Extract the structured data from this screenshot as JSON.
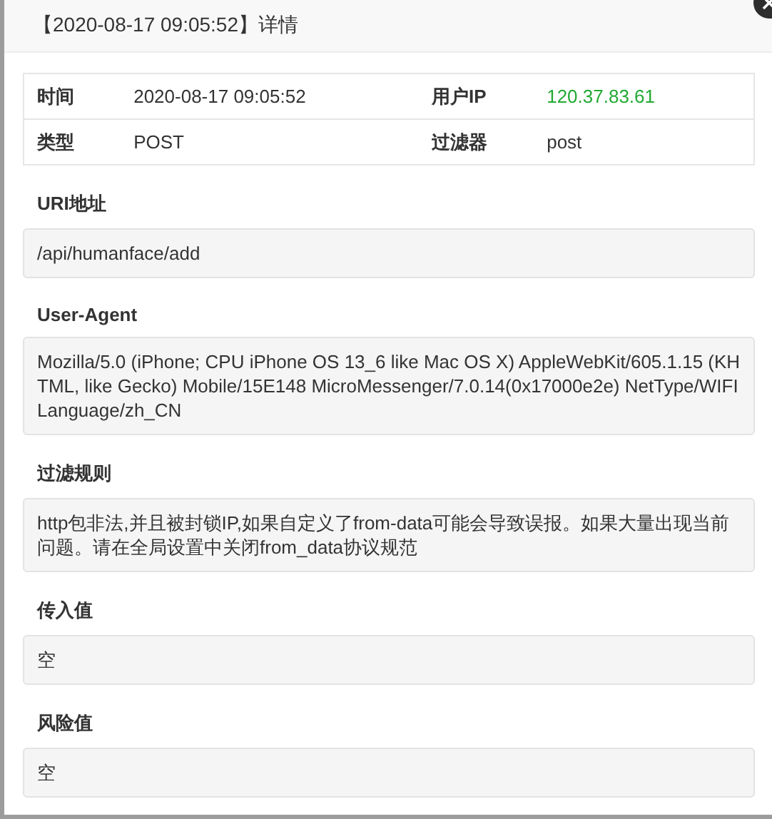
{
  "dialog": {
    "title": "【2020-08-17 09:05:52】详情"
  },
  "info_table": {
    "rows": [
      {
        "cells": [
          {
            "label": "时间",
            "value": "2020-08-17 09:05:52",
            "kind": "plain"
          },
          {
            "label": "用户IP",
            "value": "120.37.83.61",
            "kind": "highlight"
          }
        ]
      },
      {
        "cells": [
          {
            "label": "类型",
            "value": "POST",
            "kind": "plain"
          },
          {
            "label": "过滤器",
            "value": "post",
            "kind": "plain"
          }
        ]
      }
    ]
  },
  "sections": [
    {
      "label": "URI地址",
      "value": "/api/humanface/add"
    },
    {
      "label": "User-Agent",
      "value": "Mozilla/5.0 (iPhone; CPU iPhone OS 13_6 like Mac OS X) AppleWebKit/605.1.15 (KHTML, like Gecko) Mobile/15E148 MicroMessenger/7.0.14(0x17000e2e) NetType/WIFI Language/zh_CN"
    },
    {
      "label": "过滤规则",
      "value": "http包非法,并且被封锁IP,如果自定义了from-data可能会导致误报。如果大量出现当前问题。请在全局设置中关闭from_data协议规范"
    },
    {
      "label": "传入值",
      "value": "空"
    },
    {
      "label": "风险值",
      "value": "空"
    }
  ]
}
